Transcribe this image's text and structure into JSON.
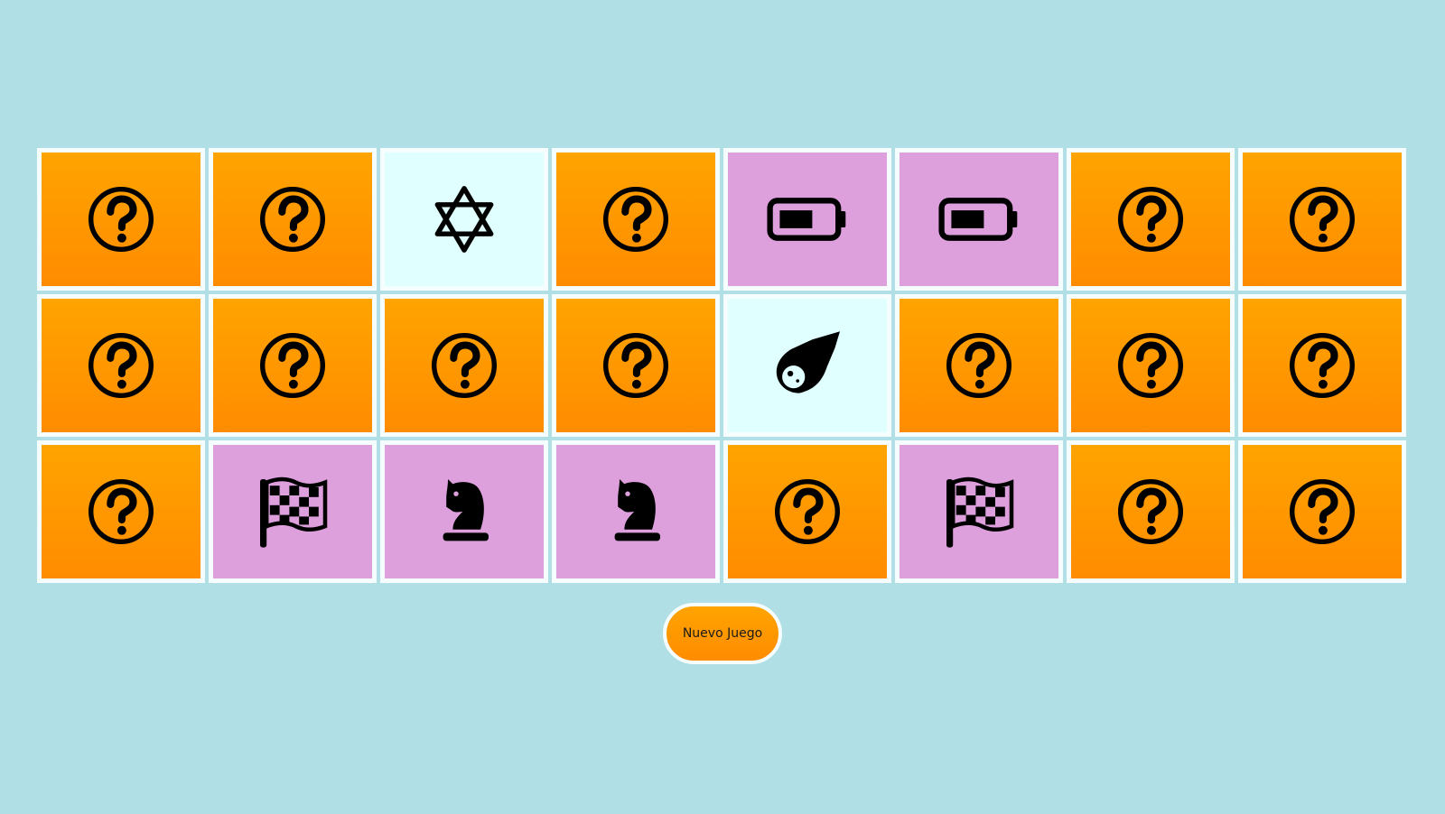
{
  "colors": {
    "background": "#b0dfe5",
    "hidden_top": "#ffa400",
    "hidden_bottom": "#ff8c00",
    "matched": "#dda0dd",
    "revealed": "#e0ffff",
    "card_border": "#f5fdff"
  },
  "board": {
    "rows": 3,
    "columns": 8,
    "cards": [
      {
        "state": "hidden",
        "icon": "question-circle-icon"
      },
      {
        "state": "hidden",
        "icon": "question-circle-icon"
      },
      {
        "state": "revealed",
        "icon": "star-of-david-icon"
      },
      {
        "state": "hidden",
        "icon": "question-circle-icon"
      },
      {
        "state": "matched",
        "icon": "battery-icon"
      },
      {
        "state": "matched",
        "icon": "battery-icon"
      },
      {
        "state": "hidden",
        "icon": "question-circle-icon"
      },
      {
        "state": "hidden",
        "icon": "question-circle-icon"
      },
      {
        "state": "hidden",
        "icon": "question-circle-icon"
      },
      {
        "state": "hidden",
        "icon": "question-circle-icon"
      },
      {
        "state": "hidden",
        "icon": "question-circle-icon"
      },
      {
        "state": "hidden",
        "icon": "question-circle-icon"
      },
      {
        "state": "revealed",
        "icon": "comet-icon"
      },
      {
        "state": "hidden",
        "icon": "question-circle-icon"
      },
      {
        "state": "hidden",
        "icon": "question-circle-icon"
      },
      {
        "state": "hidden",
        "icon": "question-circle-icon"
      },
      {
        "state": "hidden",
        "icon": "question-circle-icon"
      },
      {
        "state": "matched",
        "icon": "checkered-flag-icon"
      },
      {
        "state": "matched",
        "icon": "chess-knight-icon"
      },
      {
        "state": "matched",
        "icon": "chess-knight-icon"
      },
      {
        "state": "hidden",
        "icon": "question-circle-icon"
      },
      {
        "state": "matched",
        "icon": "checkered-flag-icon"
      },
      {
        "state": "hidden",
        "icon": "question-circle-icon"
      },
      {
        "state": "hidden",
        "icon": "question-circle-icon"
      }
    ]
  },
  "controls": {
    "new_game_label": "Nuevo Juego"
  }
}
